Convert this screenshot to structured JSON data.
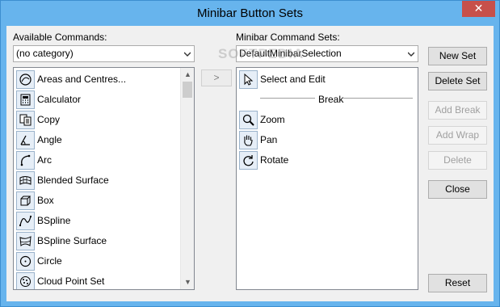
{
  "window": {
    "title": "Minibar Button Sets",
    "close_glyph": "✕"
  },
  "available": {
    "label": "Available Commands:",
    "category": "(no category)",
    "items": [
      {
        "label": "Areas and Centres...",
        "icon": "areas-centres-icon"
      },
      {
        "label": "Calculator",
        "icon": "calculator-icon"
      },
      {
        "label": "Copy",
        "icon": "copy-icon"
      },
      {
        "label": "Angle",
        "icon": "angle-icon"
      },
      {
        "label": "Arc",
        "icon": "arc-icon"
      },
      {
        "label": "Blended Surface",
        "icon": "blended-surface-icon"
      },
      {
        "label": "Box",
        "icon": "box-icon"
      },
      {
        "label": "BSpline",
        "icon": "bspline-icon"
      },
      {
        "label": "BSpline Surface",
        "icon": "bspline-surface-icon"
      },
      {
        "label": "Circle",
        "icon": "circle-icon"
      },
      {
        "label": "Cloud Point Set",
        "icon": "cloud-point-set-icon"
      }
    ]
  },
  "transfer": {
    "label": ">"
  },
  "minibar": {
    "label": "Minibar Command Sets:",
    "selected_set": "DefaultMinibarSelection",
    "items": [
      {
        "label": "Select and Edit",
        "icon": "cursor-icon"
      },
      {
        "label": "Break",
        "icon": ""
      },
      {
        "label": "Zoom",
        "icon": "zoom-icon"
      },
      {
        "label": "Pan",
        "icon": "pan-hand-icon"
      },
      {
        "label": "Rotate",
        "icon": "rotate-icon"
      }
    ]
  },
  "buttons": {
    "new_set": "New Set",
    "delete_set": "Delete Set",
    "add_break": "Add Break",
    "add_wrap": "Add Wrap",
    "delete": "Delete",
    "close": "Close",
    "reset": "Reset"
  },
  "watermark": "SOFTPEDIA"
}
